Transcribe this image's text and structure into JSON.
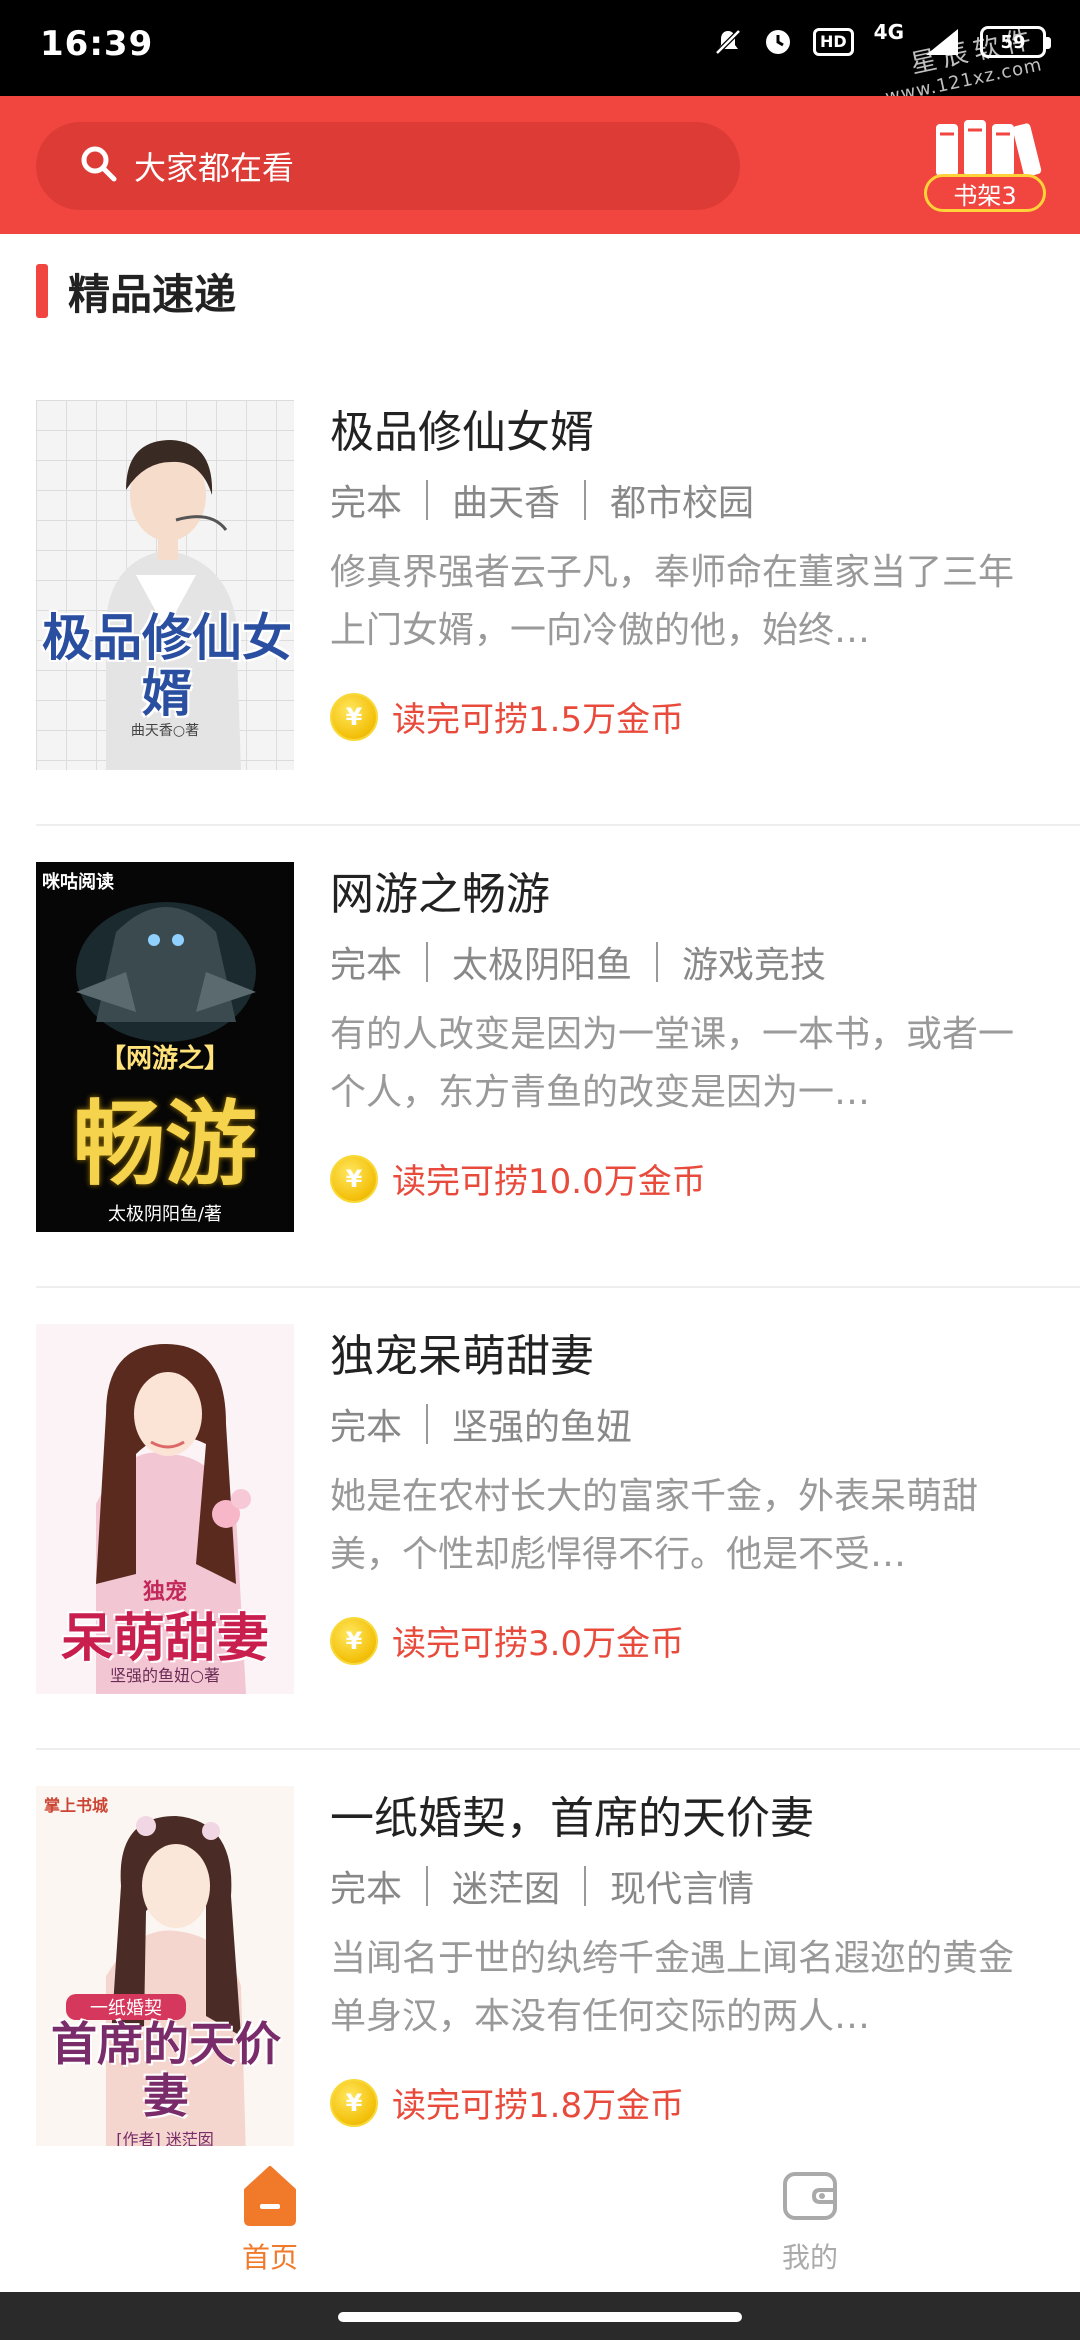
{
  "status_bar": {
    "time": "16:39",
    "hd": "HD",
    "network": "4G",
    "battery": "59",
    "icons": [
      "mute-icon",
      "alarm-icon",
      "hd-icon",
      "signal-icon",
      "battery-icon"
    ]
  },
  "watermark": {
    "title": "星辰软件",
    "url": "www.121xz.com"
  },
  "header": {
    "search_placeholder": "大家都在看",
    "bookshelf_label": "书架3",
    "accent_color": "#f0463f"
  },
  "section": {
    "title": "精品速递"
  },
  "books": [
    {
      "title": "极品修仙女婿",
      "status": "完本",
      "author": "曲天香",
      "category": "都市校园",
      "description": "修真界强者云子凡，奉师命在董家当了三年上门女婿，一向冷傲的他，始终…",
      "reward": "读完可捞1.5万金币",
      "cover_title": "极品修仙女婿",
      "cover_author": "曲天香○著"
    },
    {
      "title": "网游之畅游",
      "status": "完本",
      "author": "太极阴阳鱼",
      "category": "游戏竞技",
      "description": "有的人改变是因为一堂课，一本书，或者一个人，东方青鱼的改变是因为一…",
      "reward": "读完可捞10.0万金币",
      "cover_title_top": "【网游之】",
      "cover_title": "畅游",
      "cover_author": "太极阴阳鱼/著",
      "cover_brand": "咪咕阅读"
    },
    {
      "title": "独宠呆萌甜妻",
      "status": "完本",
      "author": "坚强的鱼妞",
      "category": "",
      "description": "她是在农村长大的富家千金，外表呆萌甜美，个性却彪悍得不行。他是不受…",
      "reward": "读完可捞3.0万金币",
      "cover_title_top": "独宠",
      "cover_title": "呆萌甜妻",
      "cover_author": "坚强的鱼妞○著"
    },
    {
      "title": "一纸婚契，首席的天价妻",
      "status": "完本",
      "author": "迷茫囡",
      "category": "现代言情",
      "description": "当闻名于世的纨绔千金遇上闻名遐迩的黄金单身汉，本没有任何交际的两人…",
      "reward": "读完可捞1.8万金币",
      "cover_title_top": "一纸婚契",
      "cover_title": "首席的天价妻",
      "cover_author": "[作者] 迷茫囡",
      "cover_brand": "掌上书城"
    }
  ],
  "coin_glyph": "¥",
  "bottom_nav": {
    "home_label": "首页",
    "mine_label": "我的",
    "active_color": "#f0792a"
  }
}
